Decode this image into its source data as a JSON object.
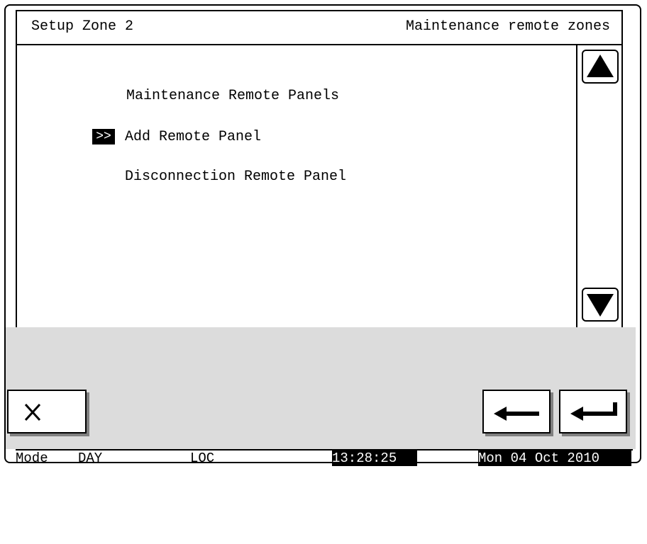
{
  "header": {
    "left_title": "Setup Zone 2",
    "right_title": "Maintenance remote zones"
  },
  "menu": {
    "title": "Maintenance Remote Panels",
    "cursor": ">>",
    "items": [
      {
        "label": "Add Remote Panel",
        "selected": true
      },
      {
        "label": "Disconnection Remote Panel",
        "selected": false
      }
    ]
  },
  "icons": {
    "scroll_up": "triangle-up-icon",
    "scroll_down": "triangle-down-icon",
    "cancel": "x-icon",
    "back": "arrow-left-icon",
    "enter": "enter-return-icon"
  },
  "status": {
    "mode_label": "Mode",
    "mode_value": "DAY",
    "access": "LOC",
    "time": "13:28:25",
    "date": "Mon 04 Oct 2010"
  },
  "colors": {
    "panel_gray": "#dcdcdc",
    "button_shadow": "#808080"
  }
}
